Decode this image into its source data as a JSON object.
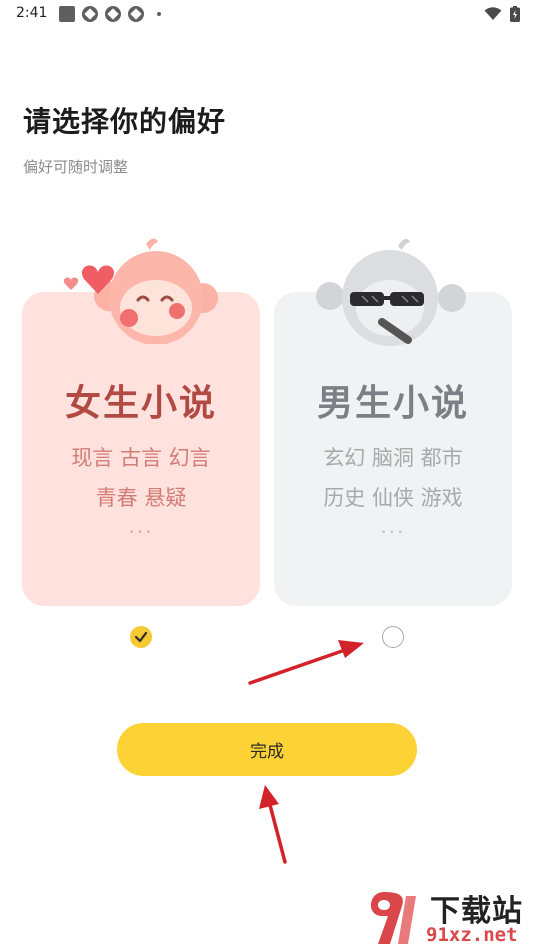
{
  "status_bar": {
    "time": "2:41"
  },
  "page": {
    "title": "请选择你的偏好",
    "subtitle": "偏好可随时调整"
  },
  "cards": [
    {
      "label": "女生小说",
      "tags_line1": "现言 古言 幻言",
      "tags_line2": "青春 悬疑",
      "more": "···",
      "selected": true,
      "accent": "#ffe1de"
    },
    {
      "label": "男生小说",
      "tags_line1": "玄幻 脑洞 都市",
      "tags_line2": "历史 仙侠 游戏",
      "more": "···",
      "selected": false,
      "accent": "#f1f2f4"
    }
  ],
  "done_button": {
    "label": "完成",
    "color": "#fdd235"
  },
  "watermark": {
    "site_name": "下载站",
    "url": "91xz.net"
  },
  "colors": {
    "arrow": "#d3232a",
    "check": "#f5c932"
  }
}
